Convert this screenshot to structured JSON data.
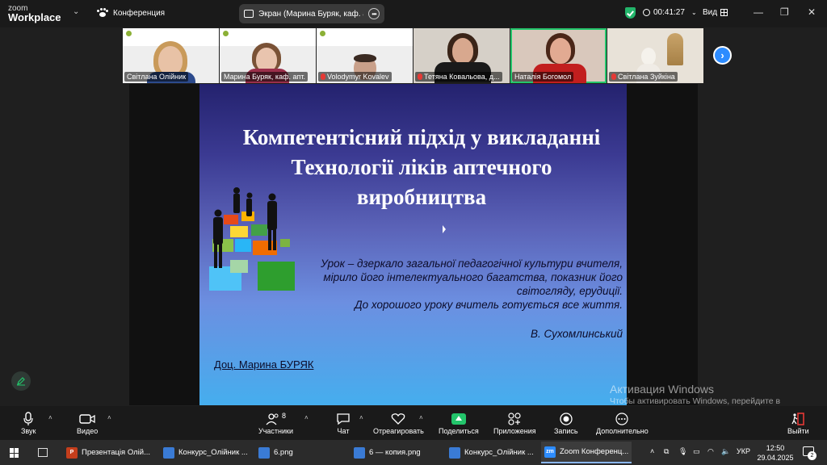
{
  "app": {
    "logo_line1": "zoom",
    "logo_line2": "Workplace",
    "meeting_label": "Конференция",
    "share_indicator": "Экран (Марина Буряк, каф. апте",
    "timer": "00:41:27",
    "view_label": "Вид",
    "window_controls": {
      "minimize": "—",
      "restore": "❐",
      "close": "✕"
    }
  },
  "participants": [
    {
      "name": "Світлана Олійник",
      "muted": false
    },
    {
      "name": "Марина Буряк, каф. апт.",
      "muted": false
    },
    {
      "name": "Volodymyr Kovalev",
      "muted": true
    },
    {
      "name": "Тетяна Ковальова, д...",
      "muted": true
    },
    {
      "name": "Наталія Богомол",
      "muted": false,
      "active": true
    },
    {
      "name": "Світлана Зуйкіна",
      "muted": true
    }
  ],
  "slide": {
    "title": "Компетентісний підхід у викладанні Технології ліків аптечного виробництва",
    "quote_lines": [
      "Урок – дзеркало загальної педагогічної культури вчителя,",
      "мірило його інтелектуального багатства, показник його",
      "світогляду, ерудиції.",
      "До хорошого уроку вчитель готується все життя."
    ],
    "author": "В. Сухомлинський",
    "presenter": "Доц. Марина БУРЯК"
  },
  "watermark": {
    "title": "Активация Windows",
    "text": "Чтобы активировать Windows, перейдите в раздел \"Параметры\"."
  },
  "toolbar": {
    "audio": "Звук",
    "video": "Видео",
    "participants": "Участники",
    "participants_count": "8",
    "chat": "Чат",
    "react": "Отреагировать",
    "share": "Поделиться",
    "apps": "Приложения",
    "record": "Запись",
    "more": "Дополнительно",
    "leave": "Выйти"
  },
  "taskbar": {
    "apps": [
      {
        "label": "Презентація Олій...",
        "icon_color": "#c43e1c",
        "icon": "P"
      },
      {
        "label": "Конкурс_Олійник ...",
        "icon_color": "#3a7bd5",
        "icon": ""
      },
      {
        "label": "6.png",
        "icon_color": "#3a7bd5",
        "icon": ""
      },
      {
        "label": "6 — копия.png",
        "icon_color": "#3a7bd5",
        "icon": ""
      },
      {
        "label": "Конкурс_Олійник ...",
        "icon_color": "#3a7bd5",
        "icon": ""
      },
      {
        "label": "Zoom Конференц...",
        "icon_color": "#2d8cff",
        "icon": "zm"
      }
    ],
    "language": "УКР",
    "time": "12:50",
    "date": "29.04.2025",
    "notifications": "2"
  }
}
